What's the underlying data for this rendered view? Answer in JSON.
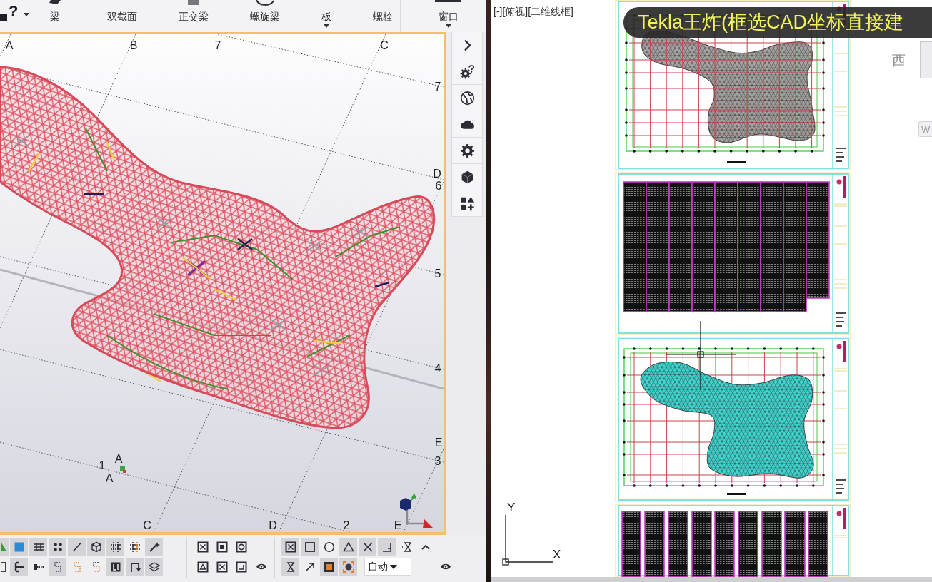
{
  "ribbon": {
    "help": {
      "glyph": "?"
    },
    "items": [
      {
        "label": "梁",
        "dropdown": false
      },
      {
        "label": "双截面",
        "dropdown": false
      },
      {
        "label": "正交梁",
        "dropdown": false
      },
      {
        "label": "螺旋梁",
        "dropdown": false
      },
      {
        "label": "板",
        "dropdown": true
      },
      {
        "label": "螺栓",
        "dropdown": false
      }
    ],
    "end_items": [
      {
        "label": "窗口",
        "dropdown": true
      }
    ]
  },
  "model_view": {
    "top_labels": [
      "A",
      "B",
      "7",
      "C"
    ],
    "right_labels": [
      "7",
      "D",
      "6",
      "5",
      "4",
      "E",
      "3"
    ],
    "bottom_labels": [
      "C",
      "D",
      "2",
      "E"
    ],
    "origin_labels": [
      "1",
      "A",
      "A"
    ]
  },
  "snap_toolbar": {
    "groups": [
      {
        "rows": [
          [
            {
              "on": true
            },
            {
              "on": true
            },
            {
              "on": true
            },
            {
              "on": true
            },
            {
              "on": true
            },
            {
              "on": true
            },
            {
              "on": true
            },
            {
              "on": false
            },
            {
              "on": true
            }
          ],
          [
            {
              "on": false
            },
            {
              "on": true
            },
            {
              "on": false
            },
            {
              "on": true
            },
            {
              "on": false
            },
            {
              "on": false
            },
            {
              "on": true
            },
            {
              "on": true
            },
            {
              "on": true
            }
          ]
        ]
      },
      {
        "rows": [
          [
            {
              "on": false
            },
            {
              "on": false
            },
            {
              "on": false
            }
          ],
          [
            {
              "on": false
            },
            {
              "on": false
            },
            {
              "on": false
            }
          ]
        ]
      },
      {
        "rows": [
          [
            {
              "on": true
            },
            {
              "on": true
            },
            {
              "on": false
            },
            {
              "on": true
            },
            {
              "on": true
            },
            {
              "on": true
            },
            {
              "on": false
            },
            {
              "on": false
            }
          ],
          [
            {
              "on": true
            },
            {
              "on": false
            },
            {
              "on": true
            },
            {
              "on": true
            }
          ]
        ]
      }
    ],
    "dropdown": {
      "value": "自动"
    }
  },
  "cad": {
    "view_label": "[-][俯视][二维线框]",
    "caption": "Tekla王炸(框选CAD坐标直接建",
    "view_cube_label": "西",
    "wcs_button": "W",
    "ucs": {
      "y_label": "Y",
      "x_label": "X"
    }
  }
}
